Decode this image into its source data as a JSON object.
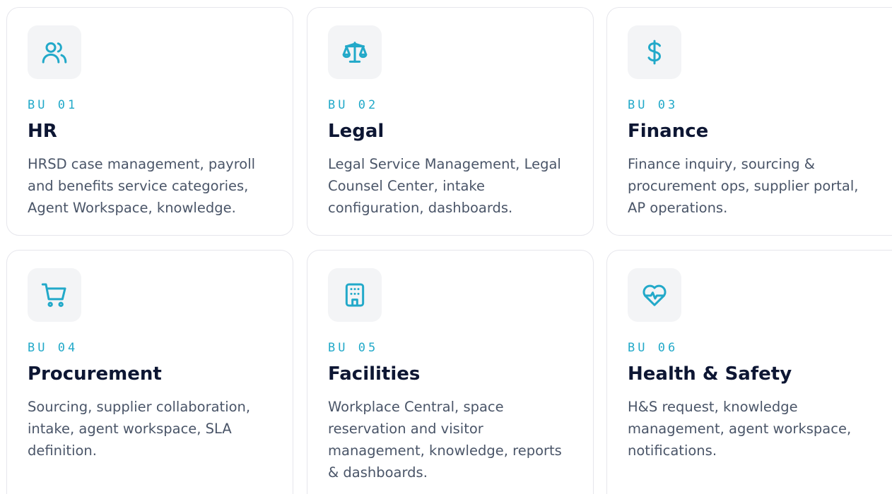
{
  "units": [
    {
      "tag": "BU 01",
      "title": "HR",
      "description": "HRSD case management, payroll and benefits service categories, Agent Workspace, knowledge.",
      "icon": "users-icon"
    },
    {
      "tag": "BU 02",
      "title": "Legal",
      "description": "Legal Service Management, Legal Counsel Center, intake configuration, dashboards.",
      "icon": "scale-icon"
    },
    {
      "tag": "BU 03",
      "title": "Finance",
      "description": "Finance inquiry, sourcing & procurement ops, supplier portal, AP operations.",
      "icon": "dollar-icon"
    },
    {
      "tag": "BU 04",
      "title": "Procurement",
      "description": "Sourcing, supplier collaboration, intake, agent workspace, SLA definition.",
      "icon": "cart-icon"
    },
    {
      "tag": "BU 05",
      "title": "Facilities",
      "description": "Workplace Central, space reservation and visitor management, knowledge, reports & dashboards.",
      "icon": "building-icon"
    },
    {
      "tag": "BU 06",
      "title": "Health & Safety",
      "description": "H&S request, knowledge management, agent workspace, notifications.",
      "icon": "heart-pulse-icon"
    }
  ],
  "colors": {
    "accent": "#22a9c9",
    "title": "#0d1633",
    "body": "#4a5568",
    "icon_bg": "#f3f4f6",
    "border": "#e6e6ec"
  }
}
